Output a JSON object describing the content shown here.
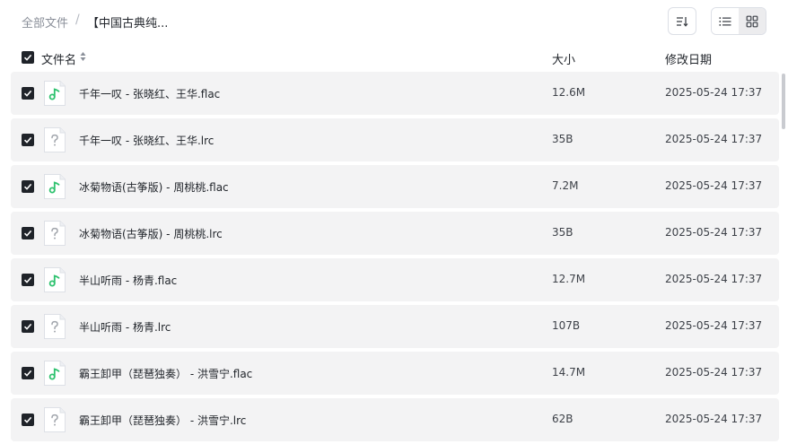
{
  "breadcrumb": {
    "root": "全部文件",
    "separator": "/",
    "current": "【中国古典纯..."
  },
  "toolbar": {
    "sort_icon": "sort-descending-icon",
    "list_view_icon": "list-view-icon",
    "grid_view_icon": "grid-view-icon",
    "active_view": "grid"
  },
  "table": {
    "columns": {
      "name": "文件名",
      "size": "大小",
      "modified": "修改日期"
    },
    "select_all_checked": true,
    "rows": [
      {
        "name": "千年一叹 - 张晓红、王华.flac",
        "size": "12.6M",
        "modified": "2025-05-24 17:37",
        "type": "audio",
        "checked": true
      },
      {
        "name": "千年一叹 - 张晓红、王华.lrc",
        "size": "35B",
        "modified": "2025-05-24 17:37",
        "type": "unknown",
        "checked": true
      },
      {
        "name": "冰菊物语(古筝版) - 周桃桃.flac",
        "size": "7.2M",
        "modified": "2025-05-24 17:37",
        "type": "audio",
        "checked": true
      },
      {
        "name": "冰菊物语(古筝版) - 周桃桃.lrc",
        "size": "35B",
        "modified": "2025-05-24 17:37",
        "type": "unknown",
        "checked": true
      },
      {
        "name": "半山听雨 - 杨青.flac",
        "size": "12.7M",
        "modified": "2025-05-24 17:37",
        "type": "audio",
        "checked": true
      },
      {
        "name": "半山听雨 - 杨青.lrc",
        "size": "107B",
        "modified": "2025-05-24 17:37",
        "type": "unknown",
        "checked": true
      },
      {
        "name": "霸王卸甲（琵琶独奏） - 洪雪宁.flac",
        "size": "14.7M",
        "modified": "2025-05-24 17:37",
        "type": "audio",
        "checked": true
      },
      {
        "name": "霸王卸甲（琵琶独奏） - 洪雪宁.lrc",
        "size": "62B",
        "modified": "2025-05-24 17:37",
        "type": "unknown",
        "checked": true
      }
    ]
  },
  "colors": {
    "audio_icon": "#2fc26f",
    "checkbox": "#1f2329",
    "row_bg": "#f3f3f4"
  }
}
